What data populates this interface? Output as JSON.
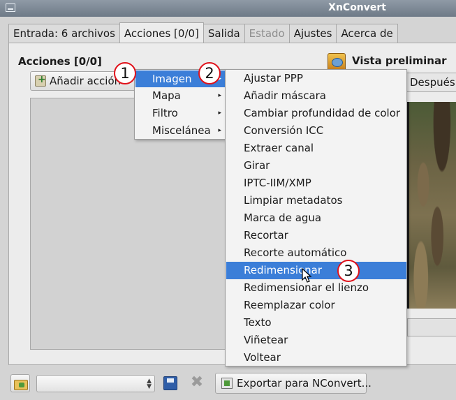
{
  "window": {
    "title": "XnConvert"
  },
  "tabs": [
    {
      "label": "Entrada: 6 archivos"
    },
    {
      "label": "Acciones [0/0]"
    },
    {
      "label": "Salida"
    },
    {
      "label": "Estado"
    },
    {
      "label": "Ajustes"
    },
    {
      "label": "Acerca de"
    }
  ],
  "actions": {
    "title": "Acciones [0/0]",
    "add_button_label": "Añadir acción"
  },
  "preview": {
    "title": "Vista preliminar",
    "after_tab": "Después"
  },
  "menu_main": {
    "items": [
      {
        "label": "Imagen",
        "highlighted": true
      },
      {
        "label": "Mapa"
      },
      {
        "label": "Filtro"
      },
      {
        "label": "Miscelánea"
      }
    ]
  },
  "menu_image": {
    "items": [
      {
        "label": "Ajustar PPP"
      },
      {
        "label": "Añadir máscara"
      },
      {
        "label": "Cambiar profundidad de color"
      },
      {
        "label": "Conversión ICC"
      },
      {
        "label": "Extraer canal"
      },
      {
        "label": "Girar"
      },
      {
        "label": "IPTC-IIM/XMP"
      },
      {
        "label": "Limpiar metadatos"
      },
      {
        "label": "Marca de agua"
      },
      {
        "label": "Recortar"
      },
      {
        "label": "Recorte automático"
      },
      {
        "label": "Redimensionar",
        "highlighted": true
      },
      {
        "label": "Redimensionar el lienzo"
      },
      {
        "label": "Reemplazar color"
      },
      {
        "label": "Texto"
      },
      {
        "label": "Viñetear"
      },
      {
        "label": "Voltear"
      }
    ]
  },
  "bottom": {
    "export_label": "Exportar para NConvert...",
    "preset_value": ""
  },
  "annotations": [
    {
      "label": "1"
    },
    {
      "label": "2"
    },
    {
      "label": "3"
    }
  ],
  "colors": {
    "highlight": "#3b7ed8",
    "badge_border": "#e0121b"
  }
}
